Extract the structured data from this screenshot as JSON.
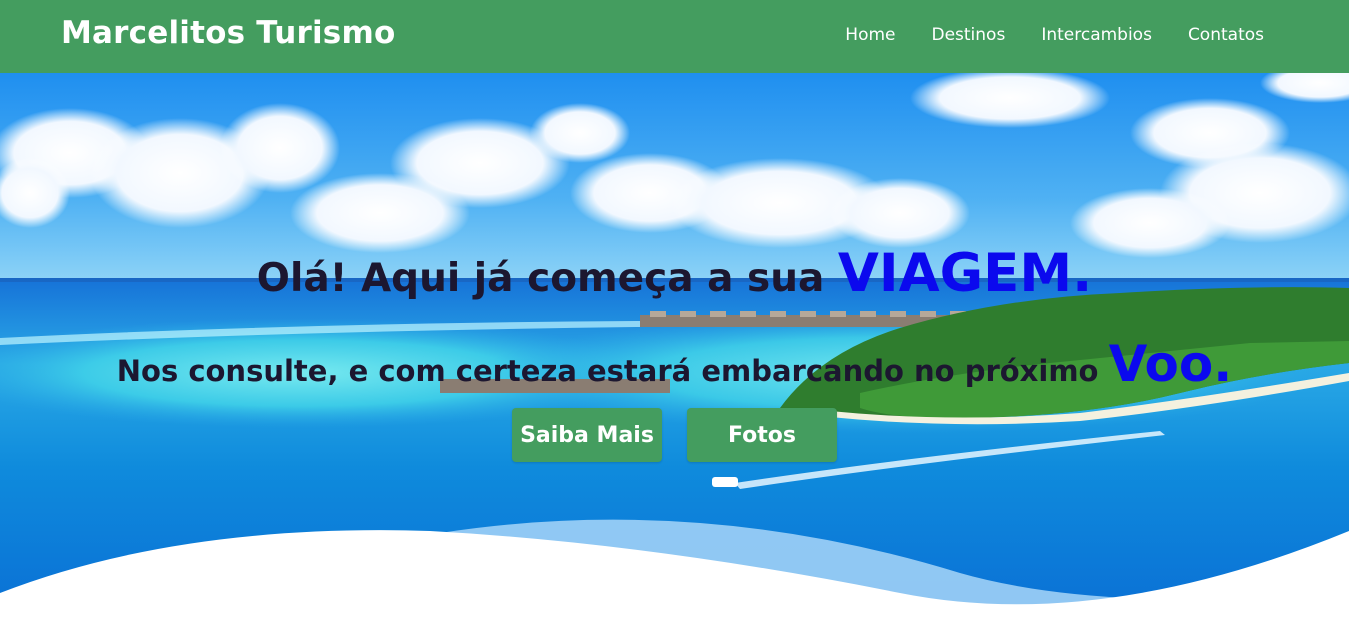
{
  "header": {
    "brand": "Marcelitos Turismo",
    "nav": [
      {
        "label": "Home"
      },
      {
        "label": "Destinos"
      },
      {
        "label": "Intercambios"
      },
      {
        "label": "Contatos"
      }
    ]
  },
  "hero": {
    "headline_text": "Olá! Aqui já começa a sua ",
    "headline_accent": "VIAGEM.",
    "subline_text": "Nos consulte, e com certeza estará embarcando no próximo ",
    "subline_accent": "Voo.",
    "buttons": {
      "more": "Saiba Mais",
      "photos": "Fotos"
    }
  },
  "colors": {
    "brand_green": "#449d5f",
    "accent_blue": "#0b09ee",
    "text_dark": "#1c1730"
  }
}
